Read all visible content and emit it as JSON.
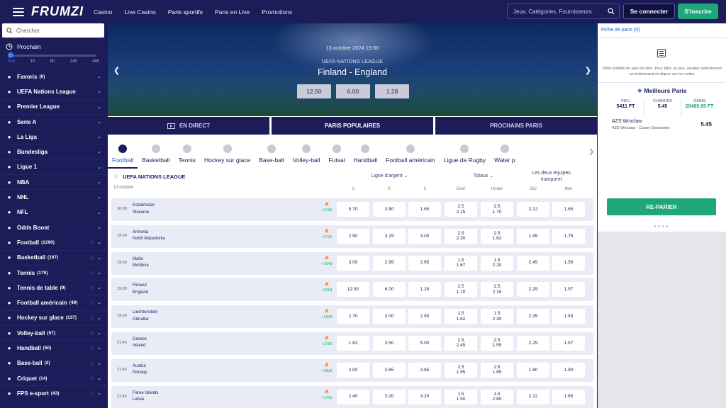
{
  "header": {
    "logo": "FRUMZI",
    "nav": [
      "Casino",
      "Live Casino",
      "Paris sportifs",
      "Paris en Live",
      "Promotions"
    ],
    "search_placeholder": "Jeux, Catégories, Fournisseurs",
    "login_label": "Se connecter",
    "signup_label": "S'inscrire"
  },
  "sidebar": {
    "search_placeholder": "Chercher",
    "prochain_label": "Prochain",
    "time_ticks": [
      "Tout",
      "1h",
      "8h",
      "24h",
      "48h"
    ],
    "items": [
      {
        "label": "Favoris",
        "count": "(0)",
        "icon": "star-icon"
      },
      {
        "label": "UEFA Nations League",
        "count": "",
        "icon": "europe-flag-icon"
      },
      {
        "label": "Premier League",
        "count": "",
        "icon": "england-flag-icon"
      },
      {
        "label": "Serie A",
        "count": "",
        "icon": "italy-flag-icon"
      },
      {
        "label": "La Liga",
        "count": "",
        "icon": "spain-flag-icon"
      },
      {
        "label": "Bundesliga",
        "count": "",
        "icon": "germany-flag-icon"
      },
      {
        "label": "Ligue 1",
        "count": "",
        "icon": "france-flag-icon"
      },
      {
        "label": "NBA",
        "count": "",
        "icon": "nba-icon"
      },
      {
        "label": "NHL",
        "count": "",
        "icon": "nhl-icon"
      },
      {
        "label": "NFL",
        "count": "",
        "icon": "nfl-icon"
      },
      {
        "label": "Odds Boost",
        "count": "",
        "icon": "boost-icon"
      },
      {
        "label": "Football",
        "count": "(1290)",
        "icon": "football-icon"
      },
      {
        "label": "Basketball",
        "count": "(167)",
        "icon": "basketball-icon"
      },
      {
        "label": "Tennis",
        "count": "(179)",
        "icon": "tennis-icon"
      },
      {
        "label": "Tennis de table",
        "count": "(9)",
        "icon": "table-tennis-icon"
      },
      {
        "label": "Football américain",
        "count": "(49)",
        "icon": "american-football-icon"
      },
      {
        "label": "Hockey sur glace",
        "count": "(137)",
        "icon": "ice-hockey-icon"
      },
      {
        "label": "Volley-ball",
        "count": "(57)",
        "icon": "volleyball-icon"
      },
      {
        "label": "Handball",
        "count": "(50)",
        "icon": "handball-icon"
      },
      {
        "label": "Base-ball",
        "count": "(2)",
        "icon": "baseball-icon"
      },
      {
        "label": "Criquet",
        "count": "(14)",
        "icon": "cricket-icon"
      },
      {
        "label": "FPS e-sport",
        "count": "(43)",
        "icon": "esport-icon"
      }
    ]
  },
  "hero": {
    "date": "13 octobre 2024 19:00",
    "league": "UEFA NATIONS LEAGUE",
    "match": "Finland - England",
    "odds": [
      "12.50",
      "6.00",
      "1.28"
    ]
  },
  "tabs": [
    "EN DIRECT",
    "PARIS POPULAIRES",
    "PROCHAINS PARIS"
  ],
  "sports": [
    "Football",
    "Basketball",
    "Tennis",
    "Hockey sur glace",
    "Base-ball",
    "Volley-ball",
    "Futsal",
    "Handball",
    "Football américain",
    "Ligue de Rugby",
    "Water p"
  ],
  "table": {
    "league": "UEFA NATIONS LEAGUE",
    "date": "13 octobre",
    "group_moneyline": "Ligne d'argent",
    "group_totals": "Totaux",
    "group_btts": "Les deux équipes marquent",
    "cols": [
      "1",
      "X",
      "2",
      "Over",
      "Under",
      "Oui",
      "Non"
    ],
    "rows": [
      {
        "time": "16:00",
        "home": "Kazakhstan",
        "away": "Slovenia",
        "pop": "+1796",
        "o1": "5.70",
        "ox": "3.80",
        "o2": "1.65",
        "ov_l": "2.5",
        "ov": "2.15",
        "un_l": "2.5",
        "un": "1.70",
        "yes": "2.12",
        "no": "1.65"
      },
      {
        "time": "19:00",
        "home": "Armenia",
        "away": "North Macedonia",
        "pop": "+1731",
        "o1": "2.50",
        "ox": "3.15",
        "o2": "3.00",
        "ov_l": "2.5",
        "ov": "2.30",
        "un_l": "2.5",
        "un": "1.62",
        "yes": "1.95",
        "no": "1.75"
      },
      {
        "time": "19:00",
        "home": "Malta",
        "away": "Moldova",
        "pop": "+1649",
        "o1": "3.00",
        "ox": "2.95",
        "o2": "2.65",
        "ov_l": "1.5",
        "ov": "1.67",
        "un_l": "1.5",
        "un": "2.20",
        "yes": "2.45",
        "no": "1.50"
      },
      {
        "time": "19:00",
        "home": "Finland",
        "away": "England",
        "pop": "+2264",
        "o1": "12.50",
        "ox": "6.00",
        "o2": "1.28",
        "ov_l": "2.5",
        "ov": "1.70",
        "un_l": "2.5",
        "un": "2.15",
        "yes": "2.25",
        "no": "1.57"
      },
      {
        "time": "19:00",
        "home": "Liechtenstein",
        "away": "Gibraltar",
        "pop": "+1649",
        "o1": "2.70",
        "ox": "3.00",
        "o2": "2.90",
        "ov_l": "1.5",
        "ov": "1.62",
        "un_l": "1.5",
        "un": "2.30",
        "yes": "2.35",
        "no": "1.53"
      },
      {
        "time": "21:45",
        "home": "Greece",
        "away": "Ireland",
        "pop": "+1756",
        "o1": "1.82",
        "ox": "3.50",
        "o2": "5.00",
        "ov_l": "2.5",
        "ov": "2.45",
        "un_l": "2.5",
        "un": "1.55",
        "yes": "2.25",
        "no": "1.57"
      },
      {
        "time": "21:45",
        "home": "Austria",
        "away": "Norway",
        "pop": "+1812",
        "o1": "2.00",
        "ox": "3.65",
        "o2": "3.85",
        "ov_l": "2.5",
        "ov": "1.95",
        "un_l": "2.5",
        "un": "1.85",
        "yes": "1.80",
        "no": "1.90"
      },
      {
        "time": "21:45",
        "home": "Faroe Islands",
        "away": "Latvia",
        "pop": "+1731",
        "o1": "2.40",
        "ox": "3.20",
        "o2": "3.20",
        "ov_l": "1.5",
        "ov": "1.50",
        "un_l": "1.5",
        "un": "2.60",
        "yes": "2.12",
        "no": "1.65"
      }
    ]
  },
  "betslip": {
    "tab": "Fiche de paris (0)",
    "empty": "Votre bulletin de pari est vide. Pour faire un pari, veuillez sélectionner un événement et cliquer sur les cotes.",
    "best_title": "Meilleurs Paris",
    "stake_label": "PIEU",
    "stake": "5411 FT",
    "odds_label": "CHANCES",
    "odds": "5.45",
    "gain_label": "GAINS",
    "gain": "29489.95 FT",
    "pick_team": "AZS Wroclaw",
    "pick_match": "AZS Wroclaw - Czarni Sosnowiec",
    "pick_odd": "5.45",
    "rebet": "RE-PARIER"
  }
}
